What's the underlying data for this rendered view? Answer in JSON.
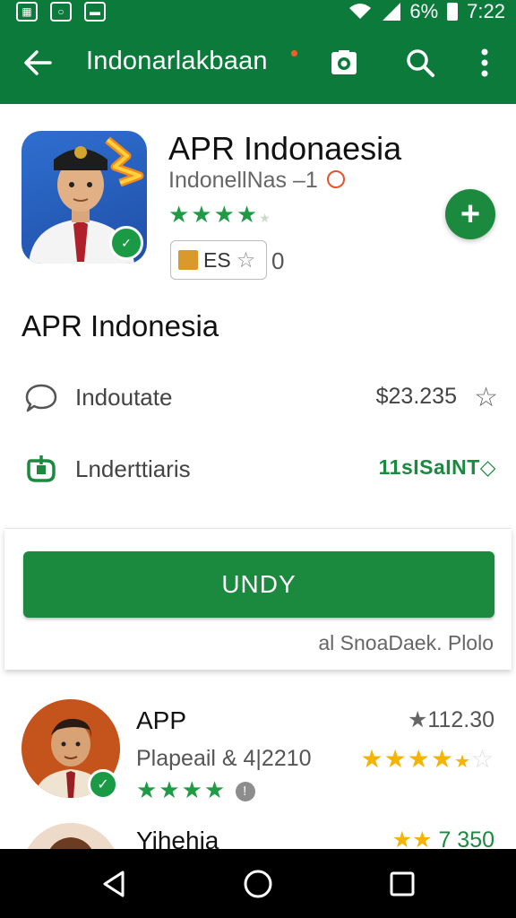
{
  "status_bar": {
    "battery": "6%",
    "time": "7:22"
  },
  "app_bar": {
    "title": "Indonarlakbaan"
  },
  "app": {
    "name": "APR Indonaesia",
    "developer": "IndonellNas –1",
    "rating_stars": "★★★★",
    "rating_partial": "★",
    "rating_value_fraction": 0.82,
    "tag_label": "ES",
    "tag_star": "☆",
    "tag_count": "0"
  },
  "section": {
    "title": "APR Indonesia"
  },
  "info_rows": [
    {
      "label": "Indoutate",
      "value": "$23.235",
      "trail": "☆"
    },
    {
      "label": "Lnderttiaris",
      "value": "11sISaINT◇"
    }
  ],
  "install_card": {
    "button_label": "UNDY",
    "note": "al SnoaDaek. Plolo"
  },
  "list": [
    {
      "title": "APP",
      "subtitle": "Plapeail & 4|2210",
      "rating": "112.30",
      "rating_star": "★",
      "gold_stars": "★★★★",
      "gold_partial": "★",
      "gold_empty": "☆",
      "green_stars": "★★★★",
      "info_mark": "!"
    },
    {
      "title": "Yihehia",
      "gold_stars": "★★",
      "rating": "7 350"
    }
  ],
  "colors": {
    "primary": "#0b7a3a",
    "accent_green": "#1b8a3f",
    "star_gold": "#f5b400"
  }
}
